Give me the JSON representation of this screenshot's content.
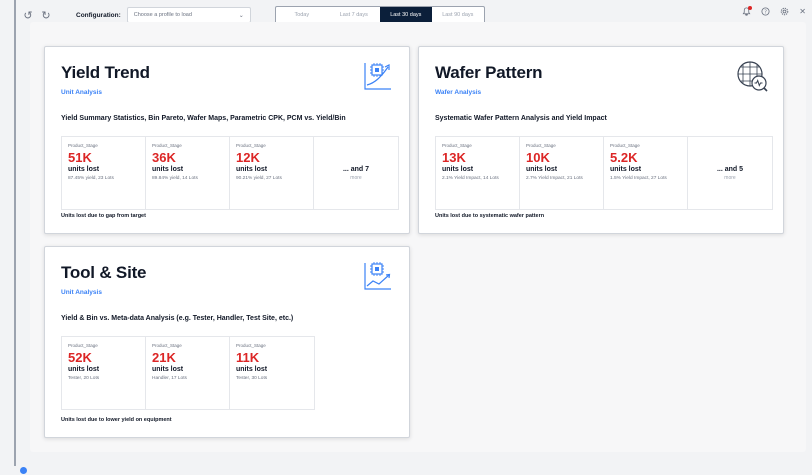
{
  "toolbar": {
    "config_label": "Configuration:",
    "profile_placeholder": "Choose a profile to load",
    "ranges": [
      "Today",
      "Last 7 days",
      "Last 30 days",
      "Last 90 days"
    ],
    "active_range": "Last 30 days"
  },
  "cards": [
    {
      "title": "Yield Trend",
      "subtitle": "Unit Analysis",
      "description": "Yield Summary Statistics, Bin Pareto, Wafer Maps, Parametric CPK, PCM vs. Yield/Bin",
      "icon": "chip-trend-icon",
      "stats": [
        {
          "stage": "Product_Stage",
          "value": "51K",
          "units": "units lost",
          "detail": "87.45% yield, 23 Lots"
        },
        {
          "stage": "Product_Stage",
          "value": "36K",
          "units": "units lost",
          "detail": "89.84% yield, 14 Lots"
        },
        {
          "stage": "Product_Stage",
          "value": "12K",
          "units": "units lost",
          "detail": "90.21% yield, 27 Lots"
        }
      ],
      "more": {
        "main": "... and 7",
        "sub": "more"
      },
      "footer": "Units lost due to gap from target"
    },
    {
      "title": "Wafer Pattern",
      "subtitle": "Wafer Analysis",
      "description": "Systematic Wafer Pattern Analysis and Yield Impact",
      "icon": "wafer-analysis-icon",
      "stats": [
        {
          "stage": "Product_Stage",
          "value": "13K",
          "units": "units lost",
          "detail": "2.1% Yield Impact, 14 Lots"
        },
        {
          "stage": "Product_Stage",
          "value": "10K",
          "units": "units lost",
          "detail": "2.7% Yield Impact, 21 Lots"
        },
        {
          "stage": "Product_Stage",
          "value": "5.2K",
          "units": "units lost",
          "detail": "1.5% Yield Impact, 27 Lots"
        }
      ],
      "more": {
        "main": "... and 5",
        "sub": "more"
      },
      "footer": "Units lost due to systematic wafer pattern"
    },
    {
      "title": "Tool & Site",
      "subtitle": "Unit Analysis",
      "description": "Yield & Bin vs. Meta-data Analysis (e.g. Tester, Handler, Test Site, etc.)",
      "icon": "chip-tool-icon",
      "stats": [
        {
          "stage": "Product_Stage",
          "value": "52K",
          "units": "units lost",
          "detail": "Tester, 20 Lots"
        },
        {
          "stage": "Product_Stage",
          "value": "21K",
          "units": "units lost",
          "detail": "Handler, 17 Lots"
        },
        {
          "stage": "Product_Stage",
          "value": "11K",
          "units": "units lost",
          "detail": "Tester, 30 Lots"
        }
      ],
      "footer": "Units lost due to lower yield on equipment"
    }
  ],
  "colors": {
    "accent": "#3b82f6",
    "loss": "#dc2626",
    "active_range_bg": "#0b1f3a"
  }
}
